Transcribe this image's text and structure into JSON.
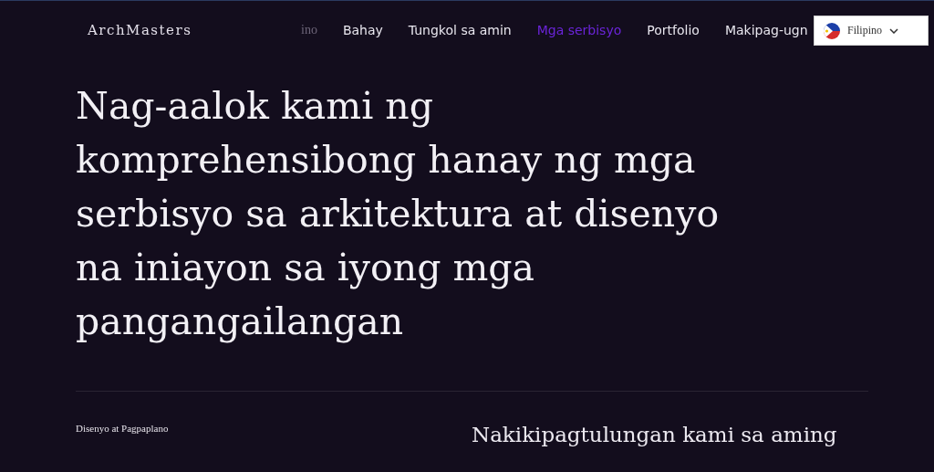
{
  "header": {
    "logo": "ArchMasters",
    "nav": [
      {
        "label": "ino",
        "selected": false,
        "kind": "faded"
      },
      {
        "label": "Bahay",
        "selected": false,
        "kind": "link"
      },
      {
        "label": "Tungkol sa amin",
        "selected": false,
        "kind": "link"
      },
      {
        "label": "Mga serbisyo",
        "selected": true,
        "kind": "link"
      },
      {
        "label": "Portfolio",
        "selected": false,
        "kind": "link"
      },
      {
        "label": "Makipag-ugn",
        "selected": false,
        "kind": "link"
      }
    ],
    "language": {
      "value": "Filipino"
    }
  },
  "hero": {
    "heading": "Nag-aalok kami ng komprehensibong hanay ng mga serbisyo sa arkitektura at disenyo na iniayon sa iyong mga pangangailangan"
  },
  "section": {
    "label": "Disenyo at Pagpaplano",
    "paragraph": "Nakikipagtulungan kami sa aming"
  }
}
